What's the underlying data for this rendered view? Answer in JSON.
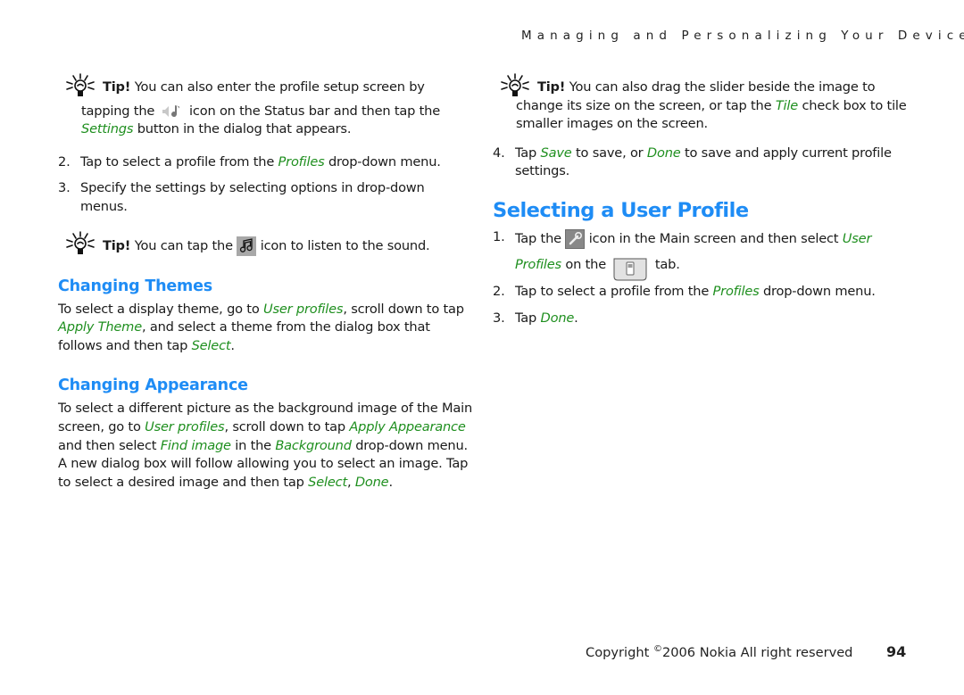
{
  "running_head": "Managing and Personalizing Your Device",
  "left": {
    "tip1": {
      "label": "Tip!",
      "text_a": " You can also enter the profile setup screen by",
      "text_b": "tapping the ",
      "icon": "speaker-note-icon",
      "text_c": " icon on the Status bar and then tap the",
      "italic_settings": "Settings",
      "text_d": " button in the dialog that appears."
    },
    "steps": [
      {
        "num": "2.",
        "pre": "Tap to select a profile from the ",
        "italic": "Profiles",
        "post": " drop-down menu."
      },
      {
        "num": "3.",
        "pre": "Specify the settings by selecting options in drop-down menus.",
        "italic": "",
        "post": ""
      }
    ],
    "tip2": {
      "label": "Tip!",
      "text_a": " You can tap the ",
      "icon": "music-note-icon",
      "text_b": " icon to listen to the sound."
    },
    "themes": {
      "heading": "Changing Themes",
      "t1": "To select a display theme, go to ",
      "i1": "User profiles",
      "t2": ", scroll down to tap ",
      "i2": "Apply Theme",
      "t3": ", and select a theme from the dialog box that follows and then tap ",
      "i3": "Select",
      "t4": "."
    },
    "appearance": {
      "heading": "Changing Appearance",
      "t1": "To select a different picture as the background image of the Main screen, go to ",
      "i1": "User profiles",
      "t2": ", scroll down to tap ",
      "i2": "Apply Appearance",
      "t3": " and then select ",
      "i3": "Find image",
      "t4": " in the ",
      "i4": "Background",
      "t5": " drop-down menu. A new dialog box will follow allowing you to select an image. Tap to select a desired image and then tap ",
      "i5": "Select",
      "t6": ", ",
      "i6": "Done",
      "t7": "."
    }
  },
  "right": {
    "tip": {
      "label": "Tip!",
      "text_a": " You can also drag the slider beside the image to change its size on the screen, or tap the ",
      "italic": "Tile",
      "text_b": " check box to tile smaller images on the screen."
    },
    "step4": {
      "num": "4.",
      "t1": "Tap ",
      "i1": "Save",
      "t2": " to save, or ",
      "i2": "Done",
      "t3": " to save and apply current profile settings."
    },
    "section": {
      "heading": "Selecting a User Profile",
      "steps": [
        {
          "num": "1.",
          "t1": "Tap the ",
          "icon": "tools-icon",
          "t2": " icon in the Main screen and then select ",
          "i1": "User Profiles",
          "t3": " on the ",
          "icon2": "phone-tab-icon",
          "t4": " tab."
        },
        {
          "num": "2.",
          "t1": "Tap to select a profile from the ",
          "i1": "Profiles",
          "t2": " drop-down menu."
        },
        {
          "num": "3.",
          "t1": "Tap ",
          "i1": "Done",
          "t2": "."
        }
      ]
    }
  },
  "footer": {
    "copyright_pre": "Copyright ",
    "copyright_symbol": "©",
    "copyright_post": "2006 Nokia All right reserved",
    "page_number": "94"
  },
  "colors": {
    "heading_blue": "#1e8cf5",
    "link_green": "#1f8f1f"
  }
}
